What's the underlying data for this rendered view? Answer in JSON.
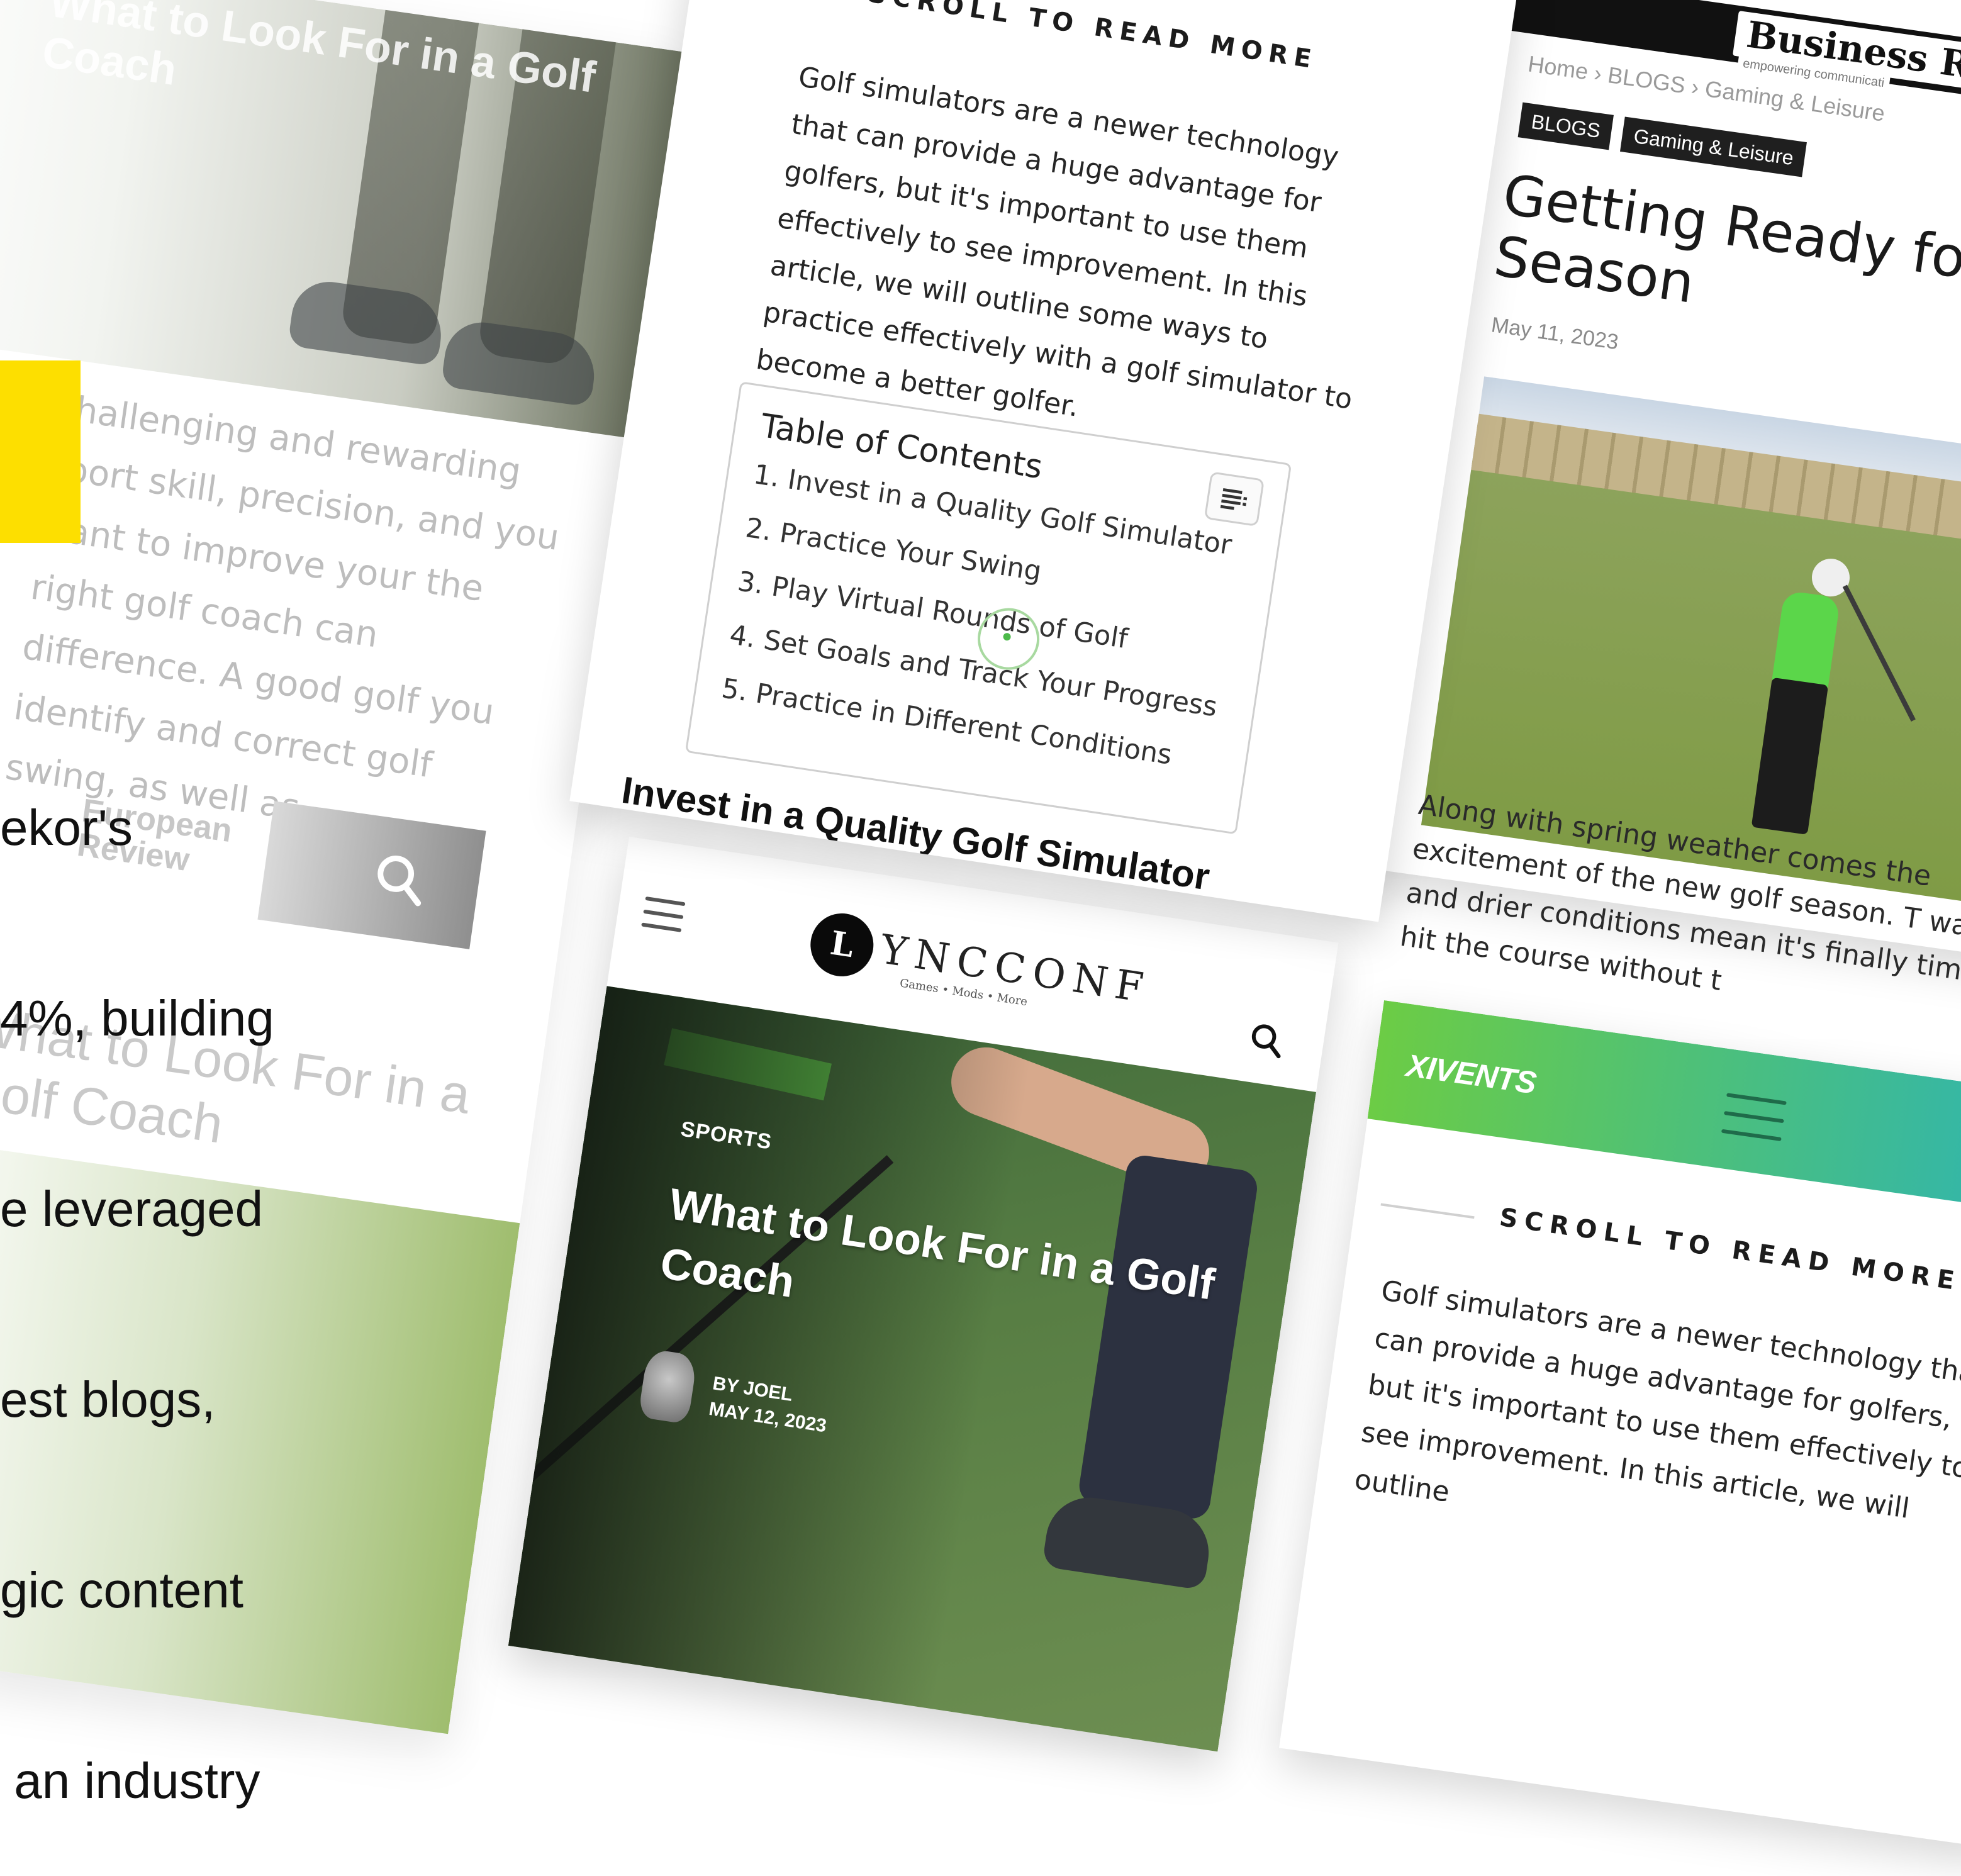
{
  "left_panel": {
    "ghost_headline": "What to Look For in a Golf Coach",
    "ghost_paragraph": "challenging and rewarding sport skill, precision, and you want to improve your the right golf coach can difference. A good golf you identify and correct golf swing, as well as",
    "ghost_logo": "European Review",
    "ghost_title": "What to Look For in a Golf Coach",
    "copy_lines": [
      "ekor's",
      "4%, building",
      "e leveraged",
      "est blogs,",
      "gic content",
      " an industry"
    ],
    "accent_color": "#fddf00"
  },
  "middle_top": {
    "scroll_label": "SCROLL TO READ MORE",
    "intro": "Golf simulators are a newer technology that can provide a huge advantage for golfers, but it's important to use them effectively to see improvement. In this article, we will outline some ways to practice effectively with a golf simulator to become a better golfer.",
    "toc": {
      "title": "Table of Contents",
      "items": [
        "1. Invest in a Quality Golf Simulator",
        "2. Practice Your Swing",
        "3. Play Virtual Rounds of Golf",
        "4. Set Goals and Track Your Progress",
        "5. Practice in Different Conditions"
      ]
    },
    "section_heading": "Invest in a Quality Golf Simulator"
  },
  "middle_bottom": {
    "brand_letter": "L",
    "brand_name": "YNCCONF",
    "brand_sub": "Games • Mods • More",
    "category": "SPORTS",
    "title": "What to Look For in a Golf Coach",
    "byline": "BY JOEL",
    "date": "MAY 12, 2023"
  },
  "right_top": {
    "brand": "Business Re",
    "tagline": "empowering communicati",
    "breadcrumbs": "Home  ›  BLOGS  ›  Gaming & Leisure",
    "tags": [
      "BLOGS",
      "Gaming & Leisure"
    ],
    "title": "Getting Ready for Season",
    "date": "May 11, 2023",
    "paragraph": "Along with spring weather comes the excitement of the new golf season. T warmer and drier conditions mean it's finally time to hit the course without t"
  },
  "right_bottom": {
    "logo": "XIVENTS",
    "scroll_label": "SCROLL TO READ MORE",
    "intro": "Golf simulators are a newer technology that can provide a huge advantage for golfers, but it's important to use them effectively to see improvement. In this article, we will outline"
  }
}
